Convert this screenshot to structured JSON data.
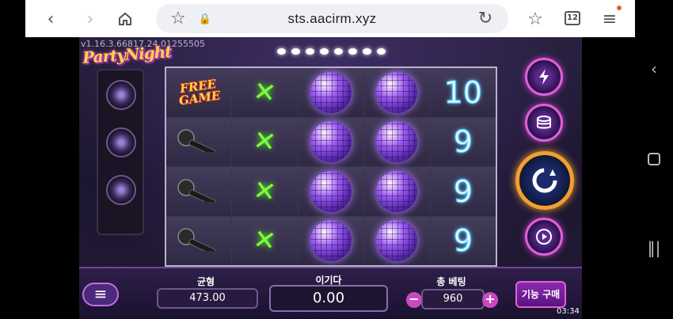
{
  "browser": {
    "url": "sts.aacirm.xyz",
    "tab_count": "12",
    "icons": [
      "back-icon",
      "forward-icon",
      "home-icon",
      "star-icon",
      "lock-icon",
      "refresh-icon",
      "bookmark-star-icon",
      "tabs-icon",
      "menu-icon"
    ]
  },
  "system_nav": {
    "icons": [
      "back-chevron-icon",
      "home-square-icon",
      "recents-icon"
    ]
  },
  "game": {
    "version": "v1.16.3.66817.24.01255505",
    "logo": "PartyNight",
    "reels": [
      [
        "FREE GAME",
        "glow-stick",
        "disco-ball",
        "disco-ball",
        "10"
      ],
      [
        "microphone",
        "glow-stick",
        "disco-ball",
        "disco-ball",
        "9"
      ],
      [
        "microphone",
        "glow-stick",
        "disco-ball",
        "disco-ball",
        "9"
      ],
      [
        "microphone",
        "glow-stick",
        "disco-ball",
        "disco-ball",
        "9"
      ]
    ],
    "controls": {
      "balance_label": "균형",
      "balance_value": "473.00",
      "win_label": "이기다",
      "win_value": "0.00",
      "bet_label": "총 베팅",
      "bet_value": "960",
      "buy_feature": "기능 구매",
      "buttons": [
        "turbo-icon",
        "coins-icon",
        "spin-icon",
        "autoplay-icon",
        "menu-icon"
      ]
    },
    "clock": "03:34",
    "accent_colors": {
      "frame": "#e060d8",
      "spin_ring": "#f0a030",
      "number": "#5ad0ff"
    }
  }
}
